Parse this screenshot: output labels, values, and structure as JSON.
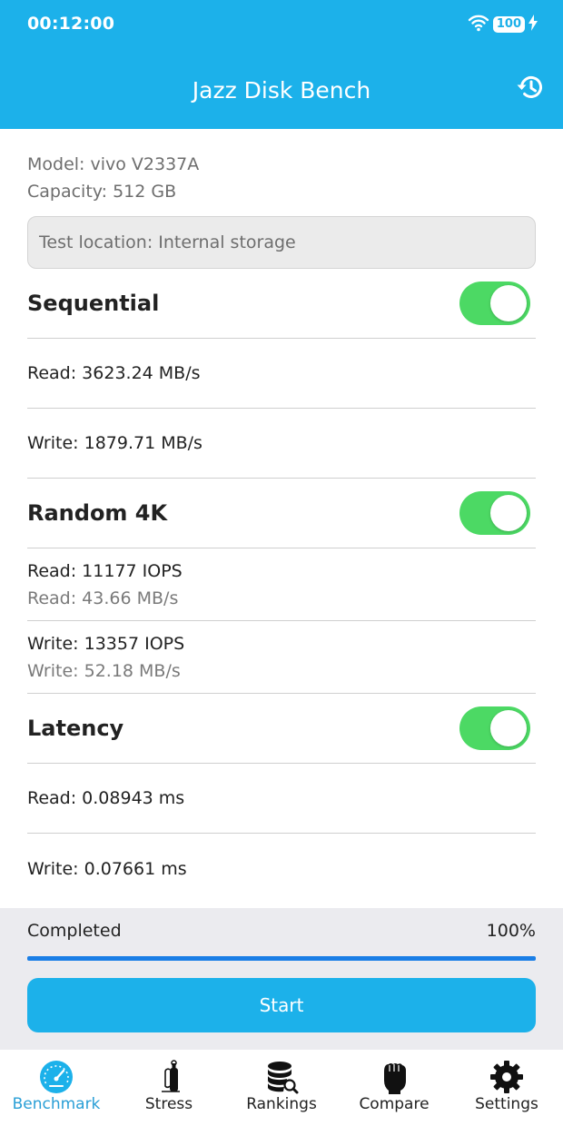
{
  "status_bar": {
    "time": "00:12:00",
    "battery": "100"
  },
  "header": {
    "title": "Jazz Disk Bench",
    "history_icon": "history-icon"
  },
  "device": {
    "model": "Model: vivo V2337A",
    "capacity": "Capacity: 512 GB",
    "test_location": "Test location: Internal storage"
  },
  "sections": {
    "sequential": {
      "title": "Sequential",
      "enabled": true,
      "read": "Read: 3623.24 MB/s",
      "write": "Write: 1879.71 MB/s"
    },
    "random4k": {
      "title": "Random 4K",
      "enabled": true,
      "read_iops": "Read: 11177 IOPS",
      "read_speed": "Read: 43.66 MB/s",
      "write_iops": "Write: 13357 IOPS",
      "write_speed": "Write: 52.18 MB/s"
    },
    "latency": {
      "title": "Latency",
      "enabled": true,
      "read": "Read: 0.08943 ms",
      "write": "Write: 0.07661 ms"
    }
  },
  "progress": {
    "label": "Completed",
    "value_text": "100%",
    "fraction": 1.0
  },
  "start_button": {
    "label": "Start"
  },
  "tabs": [
    {
      "label": "Benchmark",
      "icon": "speedometer-icon",
      "active": true
    },
    {
      "label": "Stress",
      "icon": "gas-cylinder-icon",
      "active": false
    },
    {
      "label": "Rankings",
      "icon": "database-search-icon",
      "active": false
    },
    {
      "label": "Compare",
      "icon": "fist-icon",
      "active": false
    },
    {
      "label": "Settings",
      "icon": "gear-icon",
      "active": false
    }
  ],
  "colors": {
    "primary": "#1cb1ea",
    "toggle_on": "#4cd964",
    "progress": "#1a7ee6",
    "active_tab": "#2a9fd6"
  }
}
